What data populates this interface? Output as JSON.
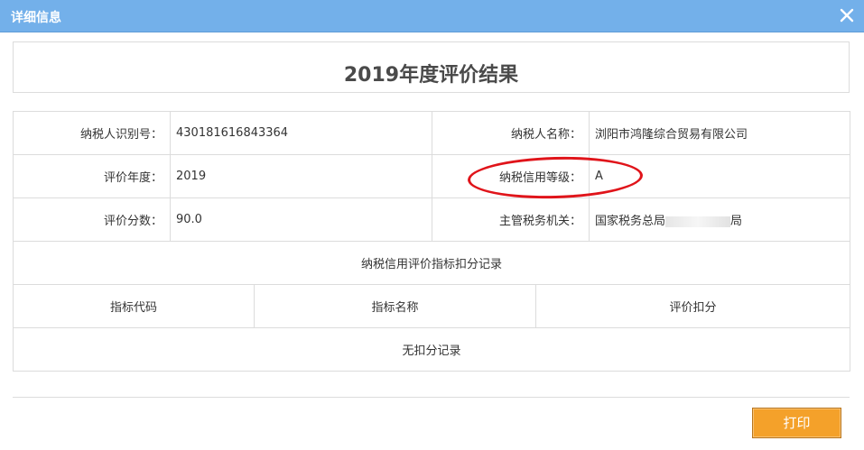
{
  "dialog": {
    "title": "详细信息",
    "heading": "2019年度评价结果"
  },
  "info": {
    "rows": [
      {
        "label1": "纳税人识别号：",
        "value1": "430181616843364",
        "label2": "纳税人名称：",
        "value2": "浏阳市鸿隆综合贸易有限公司"
      },
      {
        "label1": "评价年度：",
        "value1": "2019",
        "label2": "纳税信用等级：",
        "value2": "A"
      },
      {
        "label1": "评价分数：",
        "value1": "90.0",
        "label2": "主管税务机关：",
        "value2_prefix": "国家税务总局",
        "value2_suffix": "局"
      }
    ]
  },
  "deductions": {
    "section_title": "纳税信用评价指标扣分记录",
    "headers": [
      "指标代码",
      "指标名称",
      "评价扣分"
    ],
    "empty_text": "无扣分记录"
  },
  "footer": {
    "print_label": "打印"
  },
  "colors": {
    "titlebar": "#73b0ea",
    "highlight_oval": "#e0141a",
    "print_button": "#f4a12a"
  },
  "icons": {
    "close": "close-icon"
  }
}
